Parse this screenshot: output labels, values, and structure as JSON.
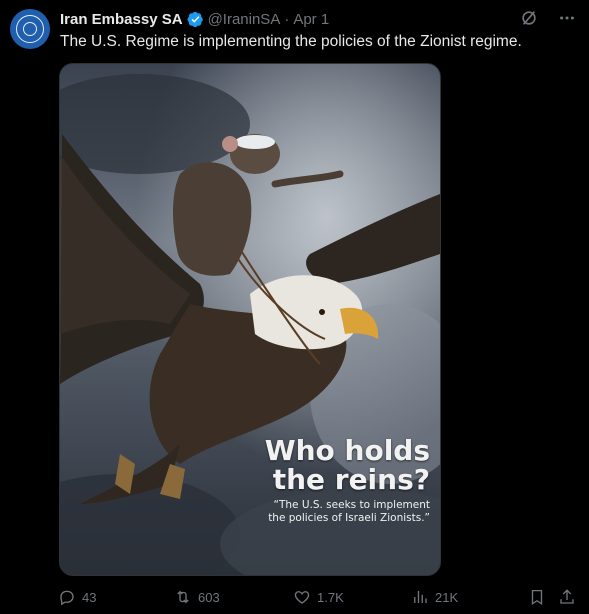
{
  "tweet": {
    "author_name": "Iran Embassy SA",
    "handle": "@IraninSA",
    "separator": "·",
    "timestamp": "Apr 1",
    "text": "The U.S. Regime is implementing the policies of the Zionist regime."
  },
  "media": {
    "title_line1": "Who holds",
    "title_line2": "the reins?",
    "subtitle_line1": "“The U.S. seeks to implement",
    "subtitle_line2": "the policies of Israeli Zionists.”"
  },
  "actions": {
    "replies": "43",
    "reposts": "603",
    "likes": "1.7K",
    "views": "21K"
  },
  "icons": {
    "verified": "verified-badge-icon",
    "grok": "grok-icon",
    "more": "more-icon",
    "reply": "reply-icon",
    "repost": "repost-icon",
    "like": "like-icon",
    "views": "views-icon",
    "bookmark": "bookmark-icon",
    "share": "share-icon"
  },
  "colors": {
    "background": "#000000",
    "text_primary": "#e7e9ea",
    "text_secondary": "#71767b",
    "verified": "#1d9bf0",
    "avatar": "#1f5fae"
  }
}
